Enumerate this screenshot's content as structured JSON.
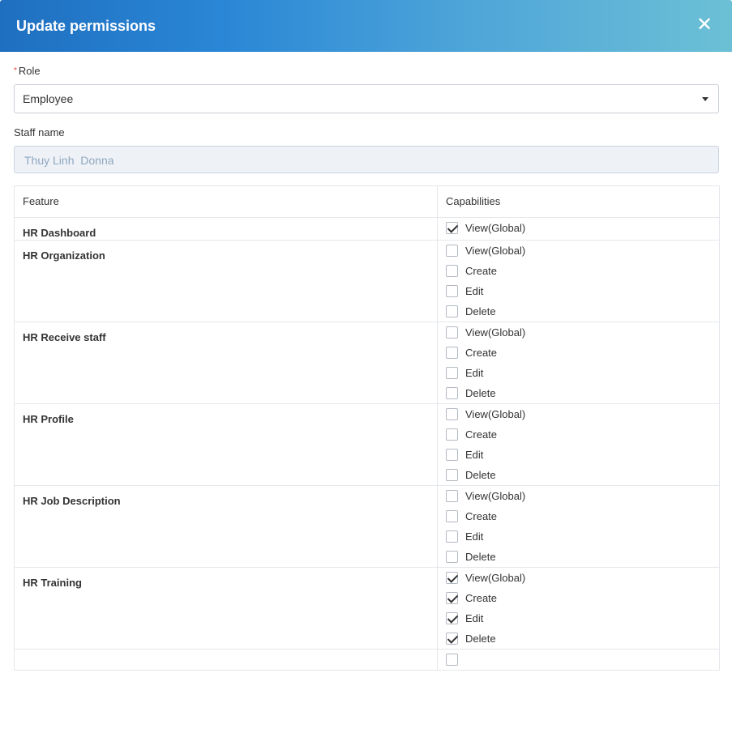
{
  "modal": {
    "title": "Update permissions",
    "close_icon": "close-icon"
  },
  "form": {
    "role_label": "Role",
    "role_required_mark": "*",
    "role_value": "Employee",
    "staff_label": "Staff name",
    "staff_value": "Thuy Linh  Donna"
  },
  "table": {
    "headers": {
      "feature": "Feature",
      "capabilities": "Capabilities"
    },
    "rows": [
      {
        "feature": "HR Dashboard",
        "caps": [
          {
            "label": "View(Global)",
            "checked": true
          }
        ]
      },
      {
        "feature": "HR Organization",
        "caps": [
          {
            "label": "View(Global)",
            "checked": false
          },
          {
            "label": "Create",
            "checked": false
          },
          {
            "label": "Edit",
            "checked": false
          },
          {
            "label": "Delete",
            "checked": false
          }
        ]
      },
      {
        "feature": "HR Receive staff",
        "caps": [
          {
            "label": "View(Global)",
            "checked": false
          },
          {
            "label": "Create",
            "checked": false
          },
          {
            "label": "Edit",
            "checked": false
          },
          {
            "label": "Delete",
            "checked": false
          }
        ]
      },
      {
        "feature": "HR Profile",
        "caps": [
          {
            "label": "View(Global)",
            "checked": false
          },
          {
            "label": "Create",
            "checked": false
          },
          {
            "label": "Edit",
            "checked": false
          },
          {
            "label": "Delete",
            "checked": false
          }
        ]
      },
      {
        "feature": "HR Job Description",
        "caps": [
          {
            "label": "View(Global)",
            "checked": false
          },
          {
            "label": "Create",
            "checked": false
          },
          {
            "label": "Edit",
            "checked": false
          },
          {
            "label": "Delete",
            "checked": false
          }
        ]
      },
      {
        "feature": "HR Training",
        "caps": [
          {
            "label": "View(Global)",
            "checked": true
          },
          {
            "label": "Create",
            "checked": true
          },
          {
            "label": "Edit",
            "checked": true
          },
          {
            "label": "Delete",
            "checked": true
          }
        ]
      },
      {
        "feature": "",
        "caps": [
          {
            "label": "",
            "checked": false
          }
        ]
      }
    ]
  }
}
